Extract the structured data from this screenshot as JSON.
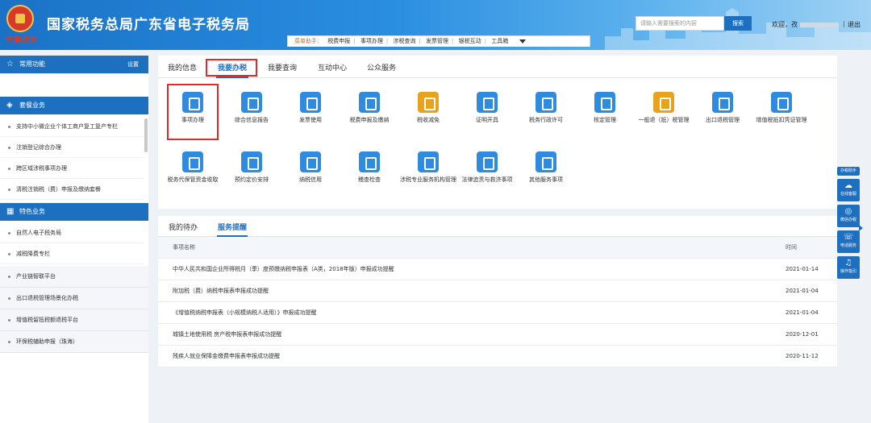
{
  "header": {
    "emblem_text": "中国税务",
    "title": "国家税务总局广东省电子税务局",
    "search_placeholder": "请输入需要搜索的内容",
    "search_button": "搜索",
    "welcome": "欢迎，孜",
    "separator": "|",
    "logout": "退出",
    "helper_label": "菜单助手：",
    "helper_items": [
      "税费申报",
      "事项办理",
      "涉税查询",
      "发票管理",
      "银税互动",
      "工具箱"
    ]
  },
  "sidebar": {
    "common": {
      "title": "常用功能",
      "settings": "设置",
      "icon": "star-icon"
    },
    "package": {
      "title": "套餐业务",
      "icon": "layers-icon",
      "items": [
        "支持中小微企业个体工商户复工复产专栏",
        "注销登记综合办理",
        "跨区域涉税事项办理",
        "清税注销税（费）申报及缴纳套餐"
      ]
    },
    "special": {
      "title": "特色业务",
      "icon": "grid-icon",
      "items": [
        "自然人电子税务局",
        "减税降费专栏"
      ]
    },
    "extra": [
      "产业链智联平台",
      "出口退税管理场景化办税",
      "增值税留抵税额退税平台",
      "环保税辅助申报（珠海）"
    ]
  },
  "tabs": [
    "我的信息",
    "我要办税",
    "我要查询",
    "互动中心",
    "公众服务"
  ],
  "services_row1": [
    {
      "label": "事项办理",
      "icon": "pencil-icon",
      "color": "#2f8be0"
    },
    {
      "label": "综合信息报告",
      "icon": "document-icon",
      "color": "#2f8be0"
    },
    {
      "label": "发票使用",
      "icon": "invoice-icon",
      "color": "#2f8be0"
    },
    {
      "label": "税费申报及缴纳",
      "icon": "box-icon",
      "color": "#2f8be0"
    },
    {
      "label": "税收减免",
      "icon": "coin-icon",
      "color": "#e8a21c"
    },
    {
      "label": "证明开具",
      "icon": "certificate-icon",
      "color": "#2f8be0"
    },
    {
      "label": "税务行政许可",
      "icon": "license-icon",
      "color": "#2f8be0"
    },
    {
      "label": "核定管理",
      "icon": "user-gear-icon",
      "color": "#2f8be0"
    },
    {
      "label": "一般退（抵）税管理",
      "icon": "refund-icon",
      "color": "#e8a21c"
    },
    {
      "label": "出口退税管理",
      "icon": "export-icon",
      "color": "#2f8be0"
    },
    {
      "label": "增值税抵扣凭证管理",
      "icon": "voucher-icon",
      "color": "#2f8be0"
    }
  ],
  "services_row2": [
    {
      "label": "税务代保管资金收取",
      "icon": "money-bag-icon",
      "color": "#2f8be0"
    },
    {
      "label": "预约定价安排",
      "icon": "calendar-icon",
      "color": "#2f8be0"
    },
    {
      "label": "纳税信用",
      "icon": "diamond-icon",
      "color": "#2f8be0"
    },
    {
      "label": "稽查检查",
      "icon": "magnifier-icon",
      "color": "#2f8be0"
    },
    {
      "label": "涉税专业服务机构管理",
      "icon": "agent-icon",
      "color": "#2f8be0"
    },
    {
      "label": "法律追责与救济事项",
      "icon": "gavel-icon",
      "color": "#2f8be0"
    },
    {
      "label": "其他服务事项",
      "icon": "more-services-icon",
      "color": "#2f8be0"
    }
  ],
  "todo": {
    "tabs": [
      "我的待办",
      "服务提醒"
    ],
    "col_name": "事项名称",
    "col_time": "时间",
    "rows": [
      {
        "name": "中华人民共和国企业所得税月（季）度预缴纳税申报表（A类，2018年版）申报成功提醒",
        "time": "2021-01-14"
      },
      {
        "name": "附加税（费）纳税申报表申报成功提醒",
        "time": "2021-01-04"
      },
      {
        "name": "《增值税纳税申报表（小规模纳税人适用）》申报成功提醒",
        "time": "2021-01-04"
      },
      {
        "name": "城镇土地使用税 房产税申报表申报成功提醒",
        "time": "2020-12-01"
      },
      {
        "name": "残疾人就业保障金缴费申报表申报成功提醒",
        "time": "2020-11-12"
      }
    ]
  },
  "float_panel": {
    "title": "办税助手",
    "buttons": [
      "在线客服",
      "微信办税",
      "电话服务",
      "操作指引"
    ]
  }
}
